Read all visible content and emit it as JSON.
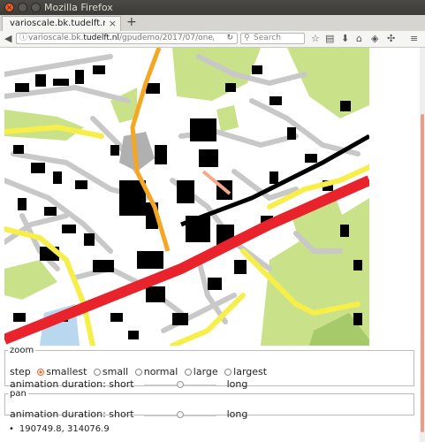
{
  "window": {
    "title": "Mozilla Firefox"
  },
  "tab": {
    "title": "varioscale.bk.tudelft.nl/gpudemo/2017/07/one/"
  },
  "navbar": {
    "url_prefix": "varioscale.bk.",
    "url_domain": "tudelft.nl",
    "url_path": "/gpudemo/2017/07/one/",
    "search_placeholder": "Search"
  },
  "zoom": {
    "legend": "zoom",
    "step_label": "step",
    "options": [
      "smallest",
      "small",
      "normal",
      "large",
      "largest"
    ],
    "selected": "smallest",
    "duration_label": "animation duration: short",
    "duration_end": "long",
    "duration_level": 0.5
  },
  "pan": {
    "legend": "pan",
    "duration_label": "animation duration: short",
    "duration_end": "long",
    "duration_level": 0.5
  },
  "coordinates": "190749.8, 314076.9",
  "colors": {
    "accent": "#e8602c",
    "map_green": "#c9e28a",
    "map_dark_green": "#a6c96a",
    "road_gray": "#c8c8c8",
    "primary_road": "#e8232b",
    "secondary_road": "#f7ee4a",
    "tertiary_road": "#f5a623",
    "water": "#b9d7ee",
    "building": "#000000"
  }
}
